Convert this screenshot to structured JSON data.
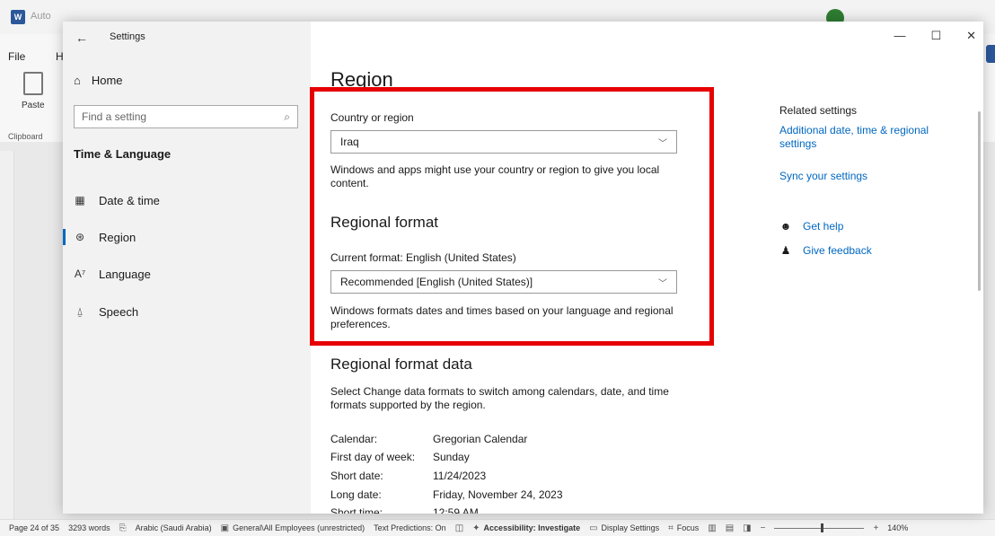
{
  "word": {
    "autosave": "Auto",
    "file_tab": "File",
    "home_tab": "H",
    "paste_label": "Paste",
    "clipboard_label": "Clipboard",
    "status": {
      "page": "Page 24 of 35",
      "words": "3293 words",
      "language": "Arabic (Saudi Arabia)",
      "sensitivity": "General\\All Employees (unrestricted)",
      "predictions": "Text Predictions: On",
      "accessibility": "Accessibility: Investigate",
      "display": "Display Settings",
      "focus": "Focus",
      "zoom": "140%"
    }
  },
  "settings": {
    "window_title": "Settings",
    "nav": {
      "home": "Home",
      "search_placeholder": "Find a setting",
      "section": "Time & Language",
      "items": [
        {
          "label": "Date & time",
          "icon": "calendar-clock-icon"
        },
        {
          "label": "Region",
          "icon": "globe-icon",
          "active": true
        },
        {
          "label": "Language",
          "icon": "language-icon"
        },
        {
          "label": "Speech",
          "icon": "microphone-icon"
        }
      ]
    },
    "main": {
      "title": "Region",
      "country_label": "Country or region",
      "country_value": "Iraq",
      "country_desc": "Windows and apps might use your country or region to give you local content.",
      "format_heading": "Regional format",
      "current_format": "Current format: English (United States)",
      "format_value": "Recommended [English (United States)]",
      "format_desc": "Windows formats dates and times based on your language and regional preferences.",
      "data_heading": "Regional format data",
      "data_desc": "Select Change data formats to switch among calendars, date, and time formats supported by the region.",
      "data_rows": [
        {
          "key": "Calendar:",
          "value": "Gregorian Calendar"
        },
        {
          "key": "First day of week:",
          "value": "Sunday"
        },
        {
          "key": "Short date:",
          "value": "11/24/2023"
        },
        {
          "key": "Long date:",
          "value": "Friday, November 24, 2023"
        },
        {
          "key": "Short time:",
          "value": "12:59 AM"
        }
      ]
    },
    "related": {
      "title": "Related settings",
      "link1": "Additional date, time & regional settings",
      "link2": "Sync your settings",
      "help": "Get help",
      "feedback": "Give feedback"
    }
  },
  "colors": {
    "accent": "#0067c0",
    "highlight": "#e60000",
    "word_brand": "#2b579a"
  }
}
